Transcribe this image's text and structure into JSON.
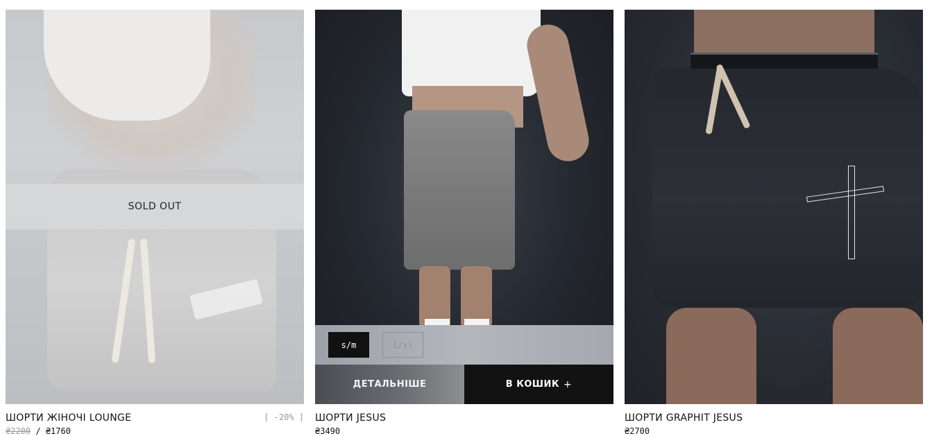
{
  "products": [
    {
      "title": "ШОРТИ ЖІНОЧІ LOUNGE",
      "discount": "[ -20% ]",
      "old_price": "₴2200",
      "separator": " / ",
      "price": "₴1760",
      "badge": "SOLD OUT"
    },
    {
      "title": "ШОРТИ JESUS",
      "price": "₴3490",
      "sizes": [
        {
          "label": "s/m",
          "state": "selected"
        },
        {
          "label": "l/xl",
          "state": "unavailable"
        }
      ],
      "details_label": "ДЕТАЛЬНІШЕ",
      "cart_label": "В КОШИК",
      "cart_icon": "+"
    },
    {
      "title": "ШОРТИ GRAPHIT JESUS",
      "price": "₴2700"
    }
  ]
}
